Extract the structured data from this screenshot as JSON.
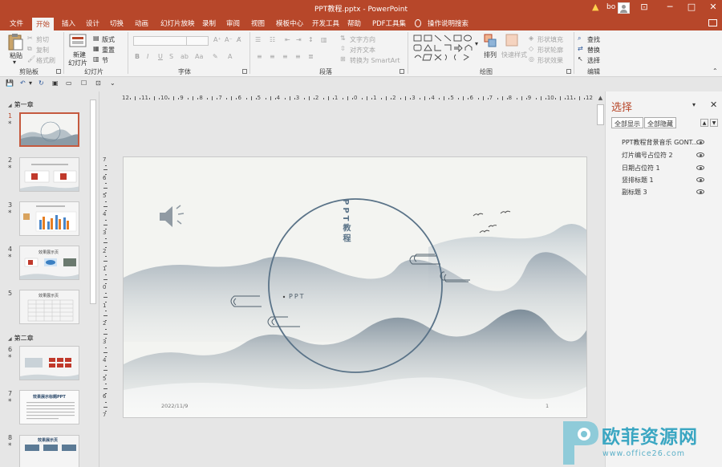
{
  "window": {
    "title": "PPT教程.pptx  -  PowerPoint",
    "user": "bo",
    "minimize_glyph": "─",
    "restore_glyph": "□",
    "close_glyph": "✕",
    "warning_glyph": "▲"
  },
  "tabs": [
    "文件",
    "开始",
    "插入",
    "设计",
    "切换",
    "动画",
    "幻灯片放映",
    "录制",
    "审阅",
    "视图",
    "模板中心",
    "开发工具",
    "帮助",
    "PDF工具集",
    "操作说明搜索"
  ],
  "ribbon": {
    "clipboard": {
      "paste": "粘贴",
      "cut": "剪切",
      "copy": "复制",
      "format_painter": "格式刷",
      "label": "剪贴板"
    },
    "slides": {
      "new_slide": "新建",
      "new_slide_2": "幻灯片",
      "layout": "版式",
      "reset": "重置",
      "section": "节",
      "label": "幻灯片"
    },
    "font": {
      "bold": "B",
      "italic": "I",
      "underline": "U",
      "strike": "S",
      "label": "字体"
    },
    "paragraph": {
      "text_direction": "文字方向",
      "align_text": "对齐文本",
      "smartart": "转换为 SmartArt",
      "label": "段落"
    },
    "drawing": {
      "arrange": "排列",
      "quick_styles": "快速样式",
      "shape_fill": "形状填充",
      "shape_outline": "形状轮廓",
      "shape_effects": "形状效果",
      "label": "绘图"
    },
    "editing": {
      "find": "查找",
      "replace": "替换",
      "select": "选择",
      "label": "编辑"
    }
  },
  "thumbnails": {
    "section1": "第一章",
    "section2": "第二章",
    "slides": [
      {
        "num": "1",
        "star": "*"
      },
      {
        "num": "2",
        "star": "*"
      },
      {
        "num": "3",
        "star": "*"
      },
      {
        "num": "4",
        "star": "*"
      },
      {
        "num": "5",
        "star": ""
      },
      {
        "num": "6",
        "star": "*"
      },
      {
        "num": "7",
        "star": "*"
      },
      {
        "num": "8",
        "star": "*"
      }
    ],
    "thumb_titles": {
      "t4": "效果展示页",
      "t5": "效果展示页",
      "t7": "效果展示标题PPT",
      "t8": "效果展示页"
    }
  },
  "ruler": {
    "h_ticks": [
      "12",
      "11",
      "10",
      "9",
      "8",
      "7",
      "6",
      "5",
      "4",
      "3",
      "2",
      "1",
      "0",
      "1",
      "2",
      "3",
      "4",
      "5",
      "6",
      "7",
      "8",
      "9",
      "10",
      "11",
      "12"
    ],
    "v_ticks": [
      "7",
      "6",
      "5",
      "4",
      "3",
      "2",
      "1",
      "0",
      "1",
      "2",
      "3",
      "4",
      "5",
      "6",
      "7"
    ]
  },
  "slide": {
    "vertical_title": "PPT教程",
    "subtitle": "PPT",
    "date": "2022/11/9",
    "page_number": "1",
    "accent": "#5a7388"
  },
  "selection_pane": {
    "title": "选择",
    "show_all": "全部显示",
    "hide_all": "全部隐藏",
    "items": [
      "PPT教程背景音乐 GONT...",
      "灯片编号占位符 2",
      "日期占位符 1",
      "竖排标题 1",
      "副标题 3"
    ]
  },
  "watermark": {
    "title": "欧菲资源网",
    "url": "www.office26.com"
  },
  "colors": {
    "brand": "#b7472a",
    "watermark": "#3aa6c2"
  }
}
